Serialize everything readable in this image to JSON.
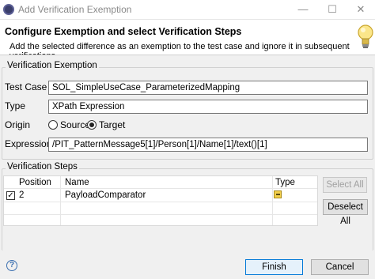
{
  "window": {
    "title": "Add Verification Exemption",
    "minimize_label": "—",
    "maximize_label": "☐",
    "close_label": "✕"
  },
  "header": {
    "title": "Configure Exemption and select Verification Steps",
    "description": "Add the selected difference as an exemption to the test case and ignore it in subsequent verifications"
  },
  "exemption": {
    "group_title": "Verification Exemption",
    "test_case_label": "Test Case",
    "test_case_value": "SOL_SimpleUseCase_ParameterizedMapping",
    "type_label": "Type",
    "type_value": "XPath Expression",
    "origin_label": "Origin",
    "origin_options": [
      "Source",
      "Target"
    ],
    "origin_selected": "Target",
    "expression_label": "Expression",
    "expression_value": "/PIT_PatternMessage5[1]/Person[1]/Name[1]/text()[1]"
  },
  "steps": {
    "group_title": "Verification Steps",
    "columns": [
      "Position",
      "Name",
      "Type"
    ],
    "rows": [
      {
        "checked": true,
        "position": "2",
        "name": "PayloadComparator",
        "type_icon": "comparator-icon"
      }
    ],
    "select_all_label": "Select All",
    "deselect_all_label": "Deselect All"
  },
  "footer": {
    "help_label": "?",
    "finish_label": "Finish",
    "cancel_label": "Cancel"
  }
}
